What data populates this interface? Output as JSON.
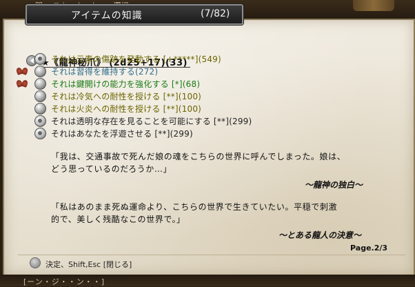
{
  "window": {
    "title": "アイテムの知識",
    "count": "(7/82)"
  },
  "background": {
    "top_text": "・聞 ・スキ・ム・ト・・選択",
    "bottom_text": "[ーン・ジ・・ン・・]"
  },
  "item": {
    "name": "★《龍神秘爪》 (2d25+17)(33)"
  },
  "properties": [
    {
      "text": "それは元素の傷跡を発動する [+*****](549)",
      "icon": "sun-rune-icon",
      "marker": "",
      "color": "#6b6400"
    },
    {
      "text": "それは習得を維持する(272)",
      "icon": "gauntlet-icon",
      "marker": "wing-marker",
      "color": "#2f6e8a"
    },
    {
      "text": "それは鍵開けの能力を強化する [*](68)",
      "icon": "lockpick-icon",
      "marker": "wing-marker",
      "color": "#1b7a14"
    },
    {
      "text": "それは冷気への耐性を授ける [**](100)",
      "icon": "cold-resist-icon",
      "marker": "",
      "color": "#6b6400"
    },
    {
      "text": "それは火炎への耐性を授ける [**](100)",
      "icon": "fire-resist-icon",
      "marker": "",
      "color": "#6b6400"
    },
    {
      "text": "それは透明な存在を見ることを可能にする [**](299)",
      "icon": "see-invisible-icon",
      "marker": "",
      "color": "#222222"
    },
    {
      "text": "それはあなたを浮遊させる [**](299)",
      "icon": "levitation-icon",
      "marker": "",
      "color": "#222222"
    }
  ],
  "lore": {
    "quote1_line1": "「我は、交通事故で死んだ娘の魂をこちらの世界に呼んでしまった。娘は、",
    "quote1_line2": "どう思っているのだろうか…」",
    "attribution1": "～龍神の独白～",
    "quote2_line1": "「私はあのまま死ぬ運命より、こちらの世界で生きていたい。平穏で刺激",
    "quote2_line2": "的で、美しく残酷なこの世界で。」",
    "attribution2": "～とある龍人の決意～"
  },
  "page": "Page.2/3",
  "footer": {
    "hint": "決定、Shift,Esc [閉じる]"
  }
}
